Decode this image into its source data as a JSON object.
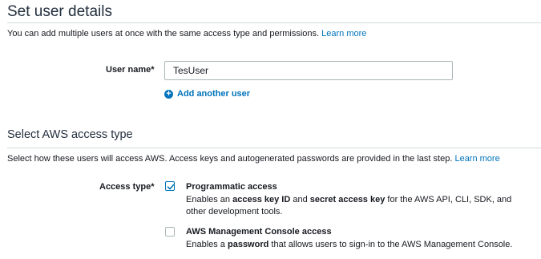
{
  "user_details": {
    "title": "Set user details",
    "description": "You can add multiple users at once with the same access type and permissions.",
    "learn_more": "Learn more",
    "user_name_label": "User name*",
    "user_name_value": "TesUser",
    "add_another_user": "Add another user"
  },
  "access_type": {
    "title": "Select AWS access type",
    "description": "Select how these users will access AWS. Access keys and autogenerated passwords are provided in the last step.",
    "learn_more": "Learn more",
    "label": "Access type*",
    "options": [
      {
        "title": "Programmatic access",
        "checked": true,
        "desc_part1": "Enables an ",
        "desc_bold1": "access key ID",
        "desc_part2": " and ",
        "desc_bold2": "secret access key",
        "desc_part3": " for the AWS API, CLI, SDK, and other development tools."
      },
      {
        "title": "AWS Management Console access",
        "checked": false,
        "desc_part1": "Enables a ",
        "desc_bold1": "password",
        "desc_part2": " that allows users to sign-in to the AWS Management Console."
      }
    ]
  },
  "colors": {
    "link": "#0073bb",
    "divider": "#d5dbdb",
    "heading": "#232f3e"
  }
}
